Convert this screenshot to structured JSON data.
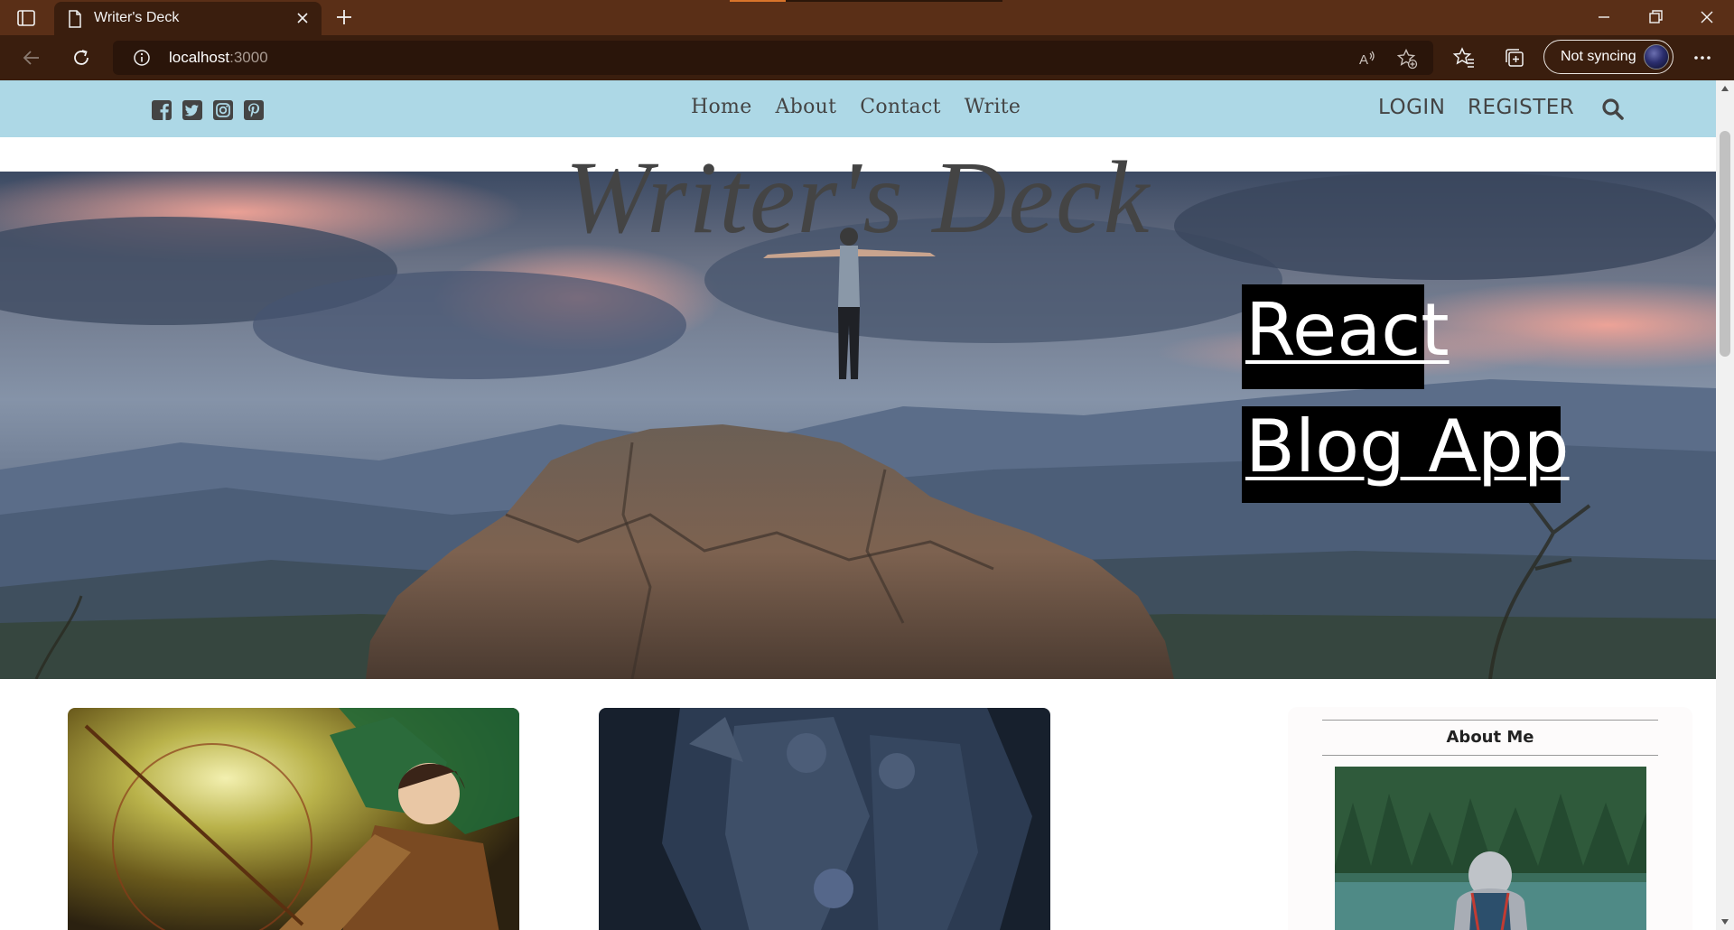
{
  "browser": {
    "tab_title": "Writer's Deck",
    "url_host": "localhost",
    "url_port": ":3000",
    "sync_label": "Not syncing"
  },
  "nav": {
    "social_icons": [
      "facebook-square-icon",
      "twitter-square-icon",
      "instagram-square-icon",
      "pinterest-square-icon"
    ],
    "links": [
      "Home",
      "About",
      "Contact",
      "Write"
    ],
    "login": "LOGIN",
    "register": "REGISTER"
  },
  "header": {
    "title": "Writer's Deck",
    "tag_line_1": "React",
    "tag_line_2": "Blog App"
  },
  "sidebar": {
    "title": "About Me"
  },
  "colors": {
    "browser_frame": "#5a2f17",
    "toolbar": "#3a1e0e",
    "nav_background": "#add8e6",
    "nav_text": "#444444",
    "title_text": "#444444",
    "tag_background": "#000000",
    "tag_text": "#ffffff"
  }
}
